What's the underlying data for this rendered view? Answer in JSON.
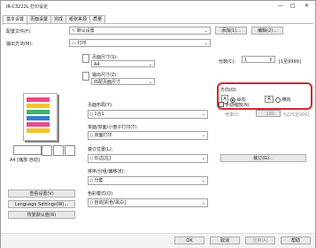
{
  "window": {
    "title": "iR-C3222L 打印设定",
    "minimize": "—",
    "maximize": "□",
    "close": "✕"
  },
  "tabs": [
    "基本设置",
    "页面设置",
    "完成",
    "纸张来源",
    "质量"
  ],
  "profile": {
    "label": "配置文件(F):",
    "value": "默认设置",
    "add": "添加(1)...",
    "edit": "编辑(2)..."
  },
  "output_method": {
    "label": "输出方法(M):",
    "value": "打印"
  },
  "page_size": {
    "label": "页面尺寸(S):",
    "value": "A4"
  },
  "output_size": {
    "label": "输出尺寸(Z):",
    "value": "匹配页面尺寸"
  },
  "copies": {
    "label": "份数(C):",
    "value": "1",
    "range": "[1至9999]"
  },
  "orientation": {
    "label": "方向(O)",
    "portrait_icon": "A",
    "portrait": "纵向",
    "landscape_icon": "A",
    "landscape": "横向",
    "selected": "portrait"
  },
  "page_layout": {
    "label": "页面布局(Y):",
    "value": "1合1"
  },
  "manual_scaling": {
    "label": "手动缩放(N)",
    "scale_label": "倍率(I):",
    "scale_value": "100",
    "scale_range": "%[25至200]"
  },
  "print_style": {
    "label": "单面/双面/小册子打印(T):",
    "value": "双面打印"
  },
  "binding": {
    "label": "装订位置(L):",
    "value": "长边[左]"
  },
  "binding_btn": "装订(G)...",
  "collate": {
    "label": "排序/分组/偏移(E):",
    "value": "分套"
  },
  "color_mode": {
    "label": "色彩模式(Q):",
    "value": "自动[彩色/黑白]"
  },
  "preview_caption": "A4 [缩放:自动]",
  "left_buttons": [
    "查看设置(V)",
    "Language Settings(W)...",
    "恢复默认值(R)"
  ],
  "footer": {
    "ok": "OK",
    "cancel": "取消",
    "apply": "应用(A)",
    "help": "帮助"
  }
}
